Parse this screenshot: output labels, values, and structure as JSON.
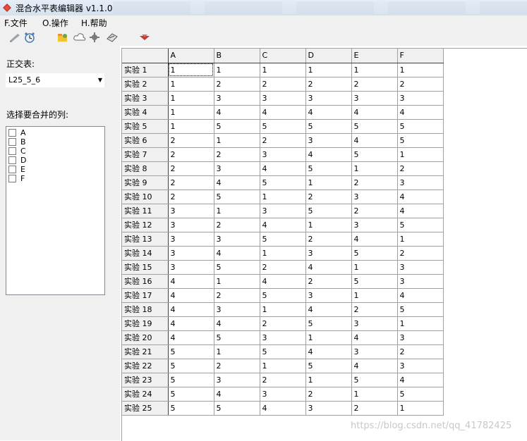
{
  "window": {
    "title": "混合水平表编辑器 v1.1.0",
    "app_icon": "diamond-icon"
  },
  "menu": [
    {
      "label": "F.文件",
      "mnemonic": "F"
    },
    {
      "label": "O.操作",
      "mnemonic": "O"
    },
    {
      "label": "H.帮助",
      "mnemonic": "H"
    }
  ],
  "toolbar": [
    "pen-icon",
    "clock-icon",
    "folder-icon",
    "cloud-icon",
    "gear-icon",
    "erase-icon",
    "red-arrow-icon"
  ],
  "left": {
    "ortho_label": "正交表:",
    "ortho_selected": "L25_5_6",
    "merge_label": "选择要合并的列:",
    "columns": [
      "A",
      "B",
      "C",
      "D",
      "E",
      "F"
    ]
  },
  "grid": {
    "headers": [
      "A",
      "B",
      "C",
      "D",
      "E",
      "F"
    ],
    "rows": [
      {
        "label": "实验 1",
        "values": [
          "1",
          "1",
          "1",
          "1",
          "1",
          "1"
        ]
      },
      {
        "label": "实验 2",
        "values": [
          "1",
          "2",
          "2",
          "2",
          "2",
          "2"
        ]
      },
      {
        "label": "实验 3",
        "values": [
          "1",
          "3",
          "3",
          "3",
          "3",
          "3"
        ]
      },
      {
        "label": "实验 4",
        "values": [
          "1",
          "4",
          "4",
          "4",
          "4",
          "4"
        ]
      },
      {
        "label": "实验 5",
        "values": [
          "1",
          "5",
          "5",
          "5",
          "5",
          "5"
        ]
      },
      {
        "label": "实验 6",
        "values": [
          "2",
          "1",
          "2",
          "3",
          "4",
          "5"
        ]
      },
      {
        "label": "实验 7",
        "values": [
          "2",
          "2",
          "3",
          "4",
          "5",
          "1"
        ]
      },
      {
        "label": "实验 8",
        "values": [
          "2",
          "3",
          "4",
          "5",
          "1",
          "2"
        ]
      },
      {
        "label": "实验 9",
        "values": [
          "2",
          "4",
          "5",
          "1",
          "2",
          "3"
        ]
      },
      {
        "label": "实验 10",
        "values": [
          "2",
          "5",
          "1",
          "2",
          "3",
          "4"
        ]
      },
      {
        "label": "实验 11",
        "values": [
          "3",
          "1",
          "3",
          "5",
          "2",
          "4"
        ]
      },
      {
        "label": "实验 12",
        "values": [
          "3",
          "2",
          "4",
          "1",
          "3",
          "5"
        ]
      },
      {
        "label": "实验 13",
        "values": [
          "3",
          "3",
          "5",
          "2",
          "4",
          "1"
        ]
      },
      {
        "label": "实验 14",
        "values": [
          "3",
          "4",
          "1",
          "3",
          "5",
          "2"
        ]
      },
      {
        "label": "实验 15",
        "values": [
          "3",
          "5",
          "2",
          "4",
          "1",
          "3"
        ]
      },
      {
        "label": "实验 16",
        "values": [
          "4",
          "1",
          "4",
          "2",
          "5",
          "3"
        ]
      },
      {
        "label": "实验 17",
        "values": [
          "4",
          "2",
          "5",
          "3",
          "1",
          "4"
        ]
      },
      {
        "label": "实验 18",
        "values": [
          "4",
          "3",
          "1",
          "4",
          "2",
          "5"
        ]
      },
      {
        "label": "实验 19",
        "values": [
          "4",
          "4",
          "2",
          "5",
          "3",
          "1"
        ]
      },
      {
        "label": "实验 20",
        "values": [
          "4",
          "5",
          "3",
          "1",
          "4",
          "3"
        ]
      },
      {
        "label": "实验 21",
        "values": [
          "5",
          "1",
          "5",
          "4",
          "3",
          "2"
        ]
      },
      {
        "label": "实验 22",
        "values": [
          "5",
          "2",
          "1",
          "5",
          "4",
          "3"
        ]
      },
      {
        "label": "实验 23",
        "values": [
          "5",
          "3",
          "2",
          "1",
          "5",
          "4"
        ]
      },
      {
        "label": "实验 24",
        "values": [
          "5",
          "4",
          "3",
          "2",
          "1",
          "5"
        ]
      },
      {
        "label": "实验 25",
        "values": [
          "5",
          "5",
          "4",
          "3",
          "2",
          "1"
        ]
      }
    ]
  },
  "watermark": "https://blog.csdn.net/qq_41782425"
}
